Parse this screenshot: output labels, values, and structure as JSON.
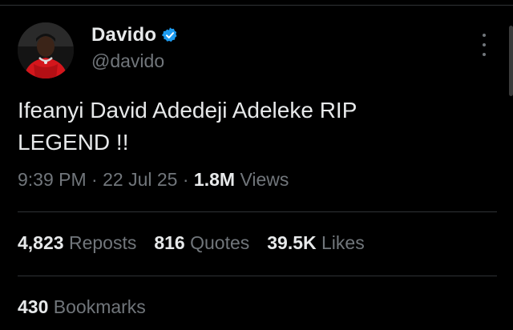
{
  "tweet": {
    "author": {
      "display_name": "Davido",
      "handle": "@davido",
      "verified": true,
      "avatar": "avatar-icon"
    },
    "text": "Ifeanyi David Adedeji Adeleke RIP\nLEGEND !!",
    "time": "9:39 PM",
    "date": "22 Jul 25",
    "separator": "·",
    "views_count": "1.8M",
    "views_label": "Views",
    "stats": {
      "reposts": {
        "count": "4,823",
        "label": "Reposts"
      },
      "quotes": {
        "count": "816",
        "label": "Quotes"
      },
      "likes": {
        "count": "39.5K",
        "label": "Likes"
      },
      "bookmarks": {
        "count": "430",
        "label": "Bookmarks"
      }
    }
  },
  "colors": {
    "background": "#000000",
    "text_primary": "#e7e9ea",
    "text_secondary": "#71767b",
    "divider": "#2f3336",
    "verified": "#1d9bf0"
  },
  "icons": {
    "verified": "verified-badge-icon",
    "more": "more-options-icon"
  }
}
